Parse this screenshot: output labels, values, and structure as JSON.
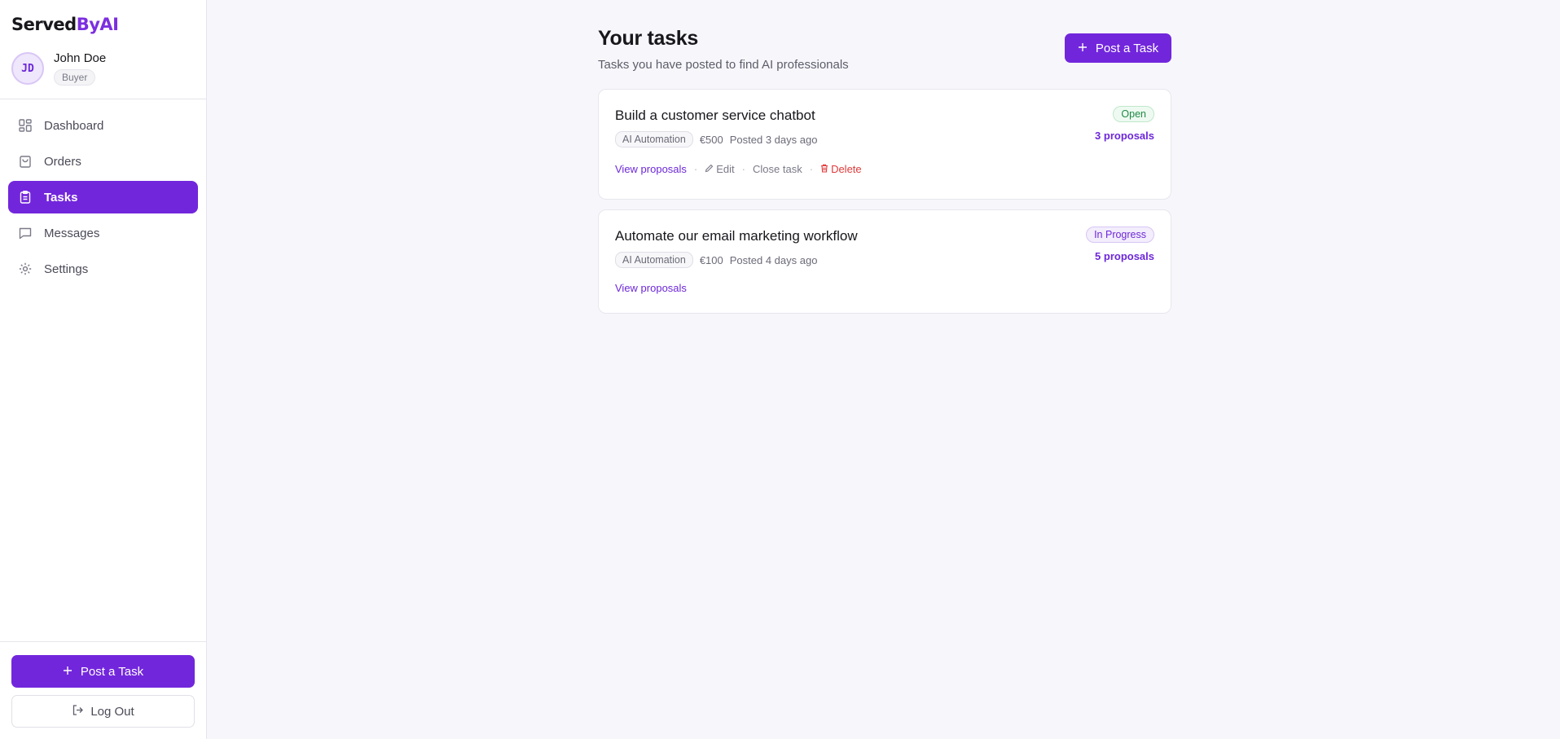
{
  "brand": {
    "part1": "Served",
    "part2": "ByAI"
  },
  "user": {
    "initials": "JD",
    "name": "John Doe",
    "role": "Buyer"
  },
  "nav": [
    {
      "label": "Dashboard",
      "icon": "dashboard-icon",
      "active": false
    },
    {
      "label": "Orders",
      "icon": "bag-icon",
      "active": false
    },
    {
      "label": "Tasks",
      "icon": "clipboard-icon",
      "active": true
    },
    {
      "label": "Messages",
      "icon": "chat-icon",
      "active": false
    },
    {
      "label": "Settings",
      "icon": "gear-icon",
      "active": false
    }
  ],
  "sidebar_bottom": {
    "post_task": "Post a Task",
    "logout": "Log Out"
  },
  "page": {
    "title": "Your tasks",
    "subtitle": "Tasks you have posted to find AI professionals",
    "post_task": "Post a Task"
  },
  "tasks": [
    {
      "title": "Build a customer service chatbot",
      "category": "AI Automation",
      "budget": "€500",
      "posted": "Posted 3 days ago",
      "status": "Open",
      "proposals": "3 proposals",
      "view": "View proposals",
      "edit": "Edit",
      "close": "Close task",
      "delete": "Delete"
    },
    {
      "title": "Automate our email marketing workflow",
      "category": "AI Automation",
      "budget": "€100",
      "posted": "Posted 4 days ago",
      "status": "In Progress",
      "proposals": "5 proposals",
      "view": "View proposals"
    }
  ],
  "colors": {
    "accent": "#7226dc",
    "open": "#1f8a46",
    "danger": "#e03a3a"
  }
}
